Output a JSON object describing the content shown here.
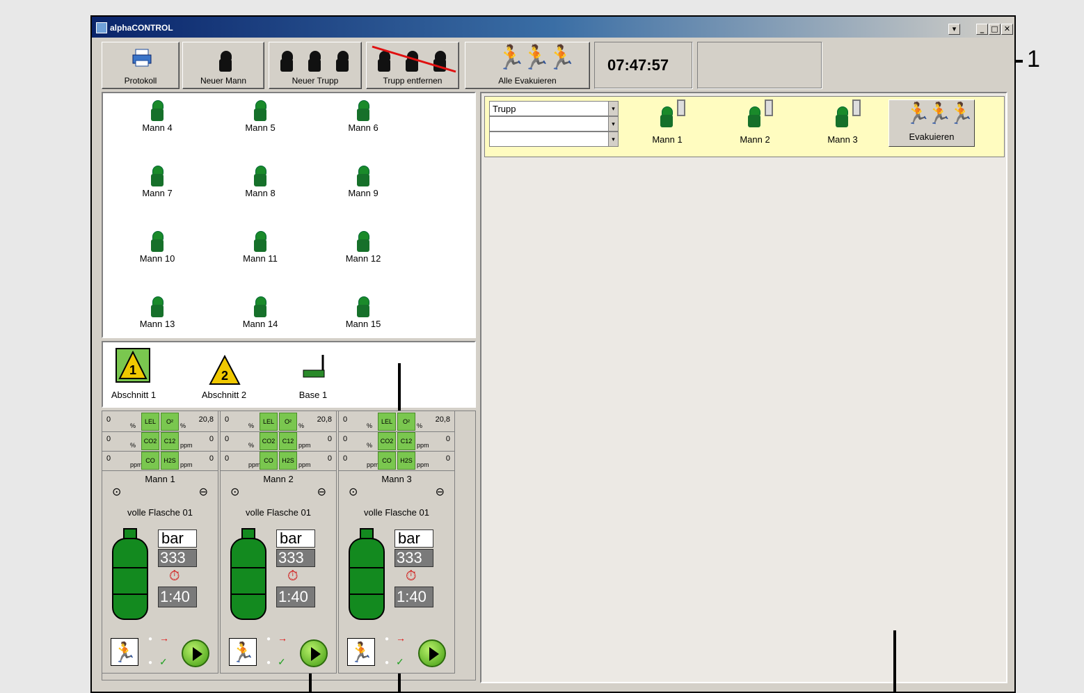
{
  "window": {
    "title": "alphaCONTROL"
  },
  "toolbar": {
    "protokoll": "Protokoll",
    "neuer_mann": "Neuer Mann",
    "neuer_trupp": "Neuer Trupp",
    "trupp_entfernen": "Trupp entfernen",
    "alle_evakuieren": "Alle Evakuieren",
    "clock": "07:47:57"
  },
  "callout": "1",
  "men": [
    "Mann 4",
    "Mann 5",
    "Mann 6",
    "Mann 7",
    "Mann 8",
    "Mann 9",
    "Mann 10",
    "Mann 11",
    "Mann 12",
    "Mann 13",
    "Mann 14",
    "Mann 15"
  ],
  "sections": [
    {
      "label": "Abschnitt 1",
      "num": "1"
    },
    {
      "label": "Abschnitt 2",
      "num": "2"
    },
    {
      "label": "Base 1"
    }
  ],
  "trupp": {
    "select_value": "Trupp",
    "members": [
      "Mann 1",
      "Mann 2",
      "Mann 3"
    ],
    "evacuate": "Evakuieren"
  },
  "cards": [
    {
      "name": "Mann 1",
      "status": "volle Flasche 01",
      "unit": "bar",
      "pressure": "333",
      "time": "1:40"
    },
    {
      "name": "Mann 2",
      "status": "volle Flasche 01",
      "unit": "bar",
      "pressure": "333",
      "time": "1:40"
    },
    {
      "name": "Mann 3",
      "status": "volle Flasche 01",
      "unit": "bar",
      "pressure": "333",
      "time": "1:40"
    }
  ],
  "gas": {
    "rows": [
      {
        "left": "0",
        "lunit": "%",
        "g1": "LEL",
        "g2": "O²",
        "runit": "%",
        "right": "20,8"
      },
      {
        "left": "0",
        "lunit": "%",
        "g1": "CO2",
        "g2": "C12",
        "runit": "ppm",
        "right": "0"
      },
      {
        "left": "0",
        "lunit": "ppm",
        "g1": "CO",
        "g2": "H2S",
        "runit": "ppm",
        "right": "0"
      }
    ]
  },
  "colors": {
    "accent_green": "#7ac74f",
    "panel_yellow": "#fffcc0",
    "title_blue": "#0a246a"
  }
}
